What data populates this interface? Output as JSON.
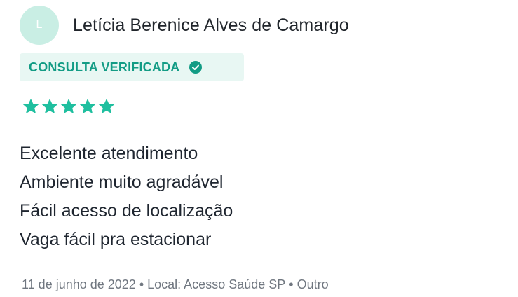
{
  "author": {
    "initial": "L",
    "name": "Letícia Berenice Alves de Camargo",
    "avatar_color": "#c9eee4"
  },
  "badge": {
    "label": "CONSULTA VERIFICADA",
    "icon": "check-circle-icon",
    "text_color": "#139c85",
    "background": "#e8f7f3"
  },
  "rating": {
    "value": 5,
    "max": 5,
    "icon": "star-icon",
    "color": "#1fbf9f"
  },
  "review": {
    "lines": [
      "Excelente atendimento",
      "Ambiente muito agradável",
      "Fácil acesso de localização",
      "Vaga fácil pra estacionar"
    ]
  },
  "meta": {
    "date": "11 de junho de 2022",
    "separator": "•",
    "location": "Local: Acesso Saúde SP",
    "type": "Outro"
  }
}
